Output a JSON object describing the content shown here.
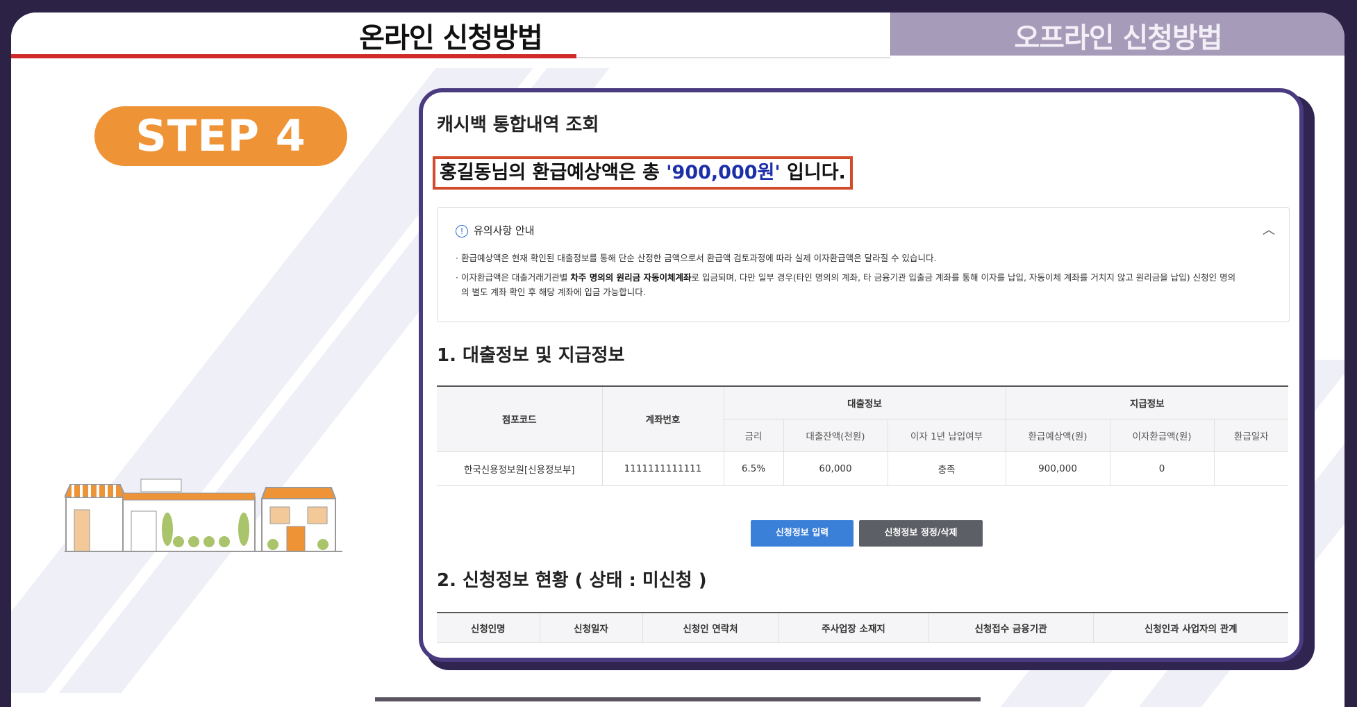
{
  "tabs": {
    "online": "온라인 신청방법",
    "offline": "오프라인 신청방법"
  },
  "step_label": "STEP 4",
  "card": {
    "title": "캐시백 통합내역 조회",
    "refund": {
      "prefix": "홍길동님의 환급예상액은 총 ",
      "amount": "'900,000원'",
      "suffix": " 입니다."
    },
    "notice": {
      "heading": "유의사항 안내",
      "line1": "· 환급예상액은 현재 확인된 대출정보를 통해 단순 산정한 금액으로서 환급액 검토과정에 따라 실제 이자환급액은 달라질 수 있습니다.",
      "line2_pre": "· 이자환급액은 대출거래기관별 ",
      "line2_bold": "차주 명의의 원리금 자동이체계좌",
      "line2_post": "로 입금되며, 다만 일부 경우(타인 명의의 계좌, 타 금융기관 입출금 계좌를 통해 이자를 납입, 자동이체 계좌를 거치지 않고 원리금을 납입) 신청인 명의",
      "line3": "의 별도 계좌 확인 후 해당 계좌에 입금 가능합니다."
    },
    "section1_title": "1. 대출정보 및 지급정보",
    "table1": {
      "h_branch": "점포코드",
      "h_account": "계좌번호",
      "h_loan": "대출정보",
      "h_pay": "지급정보",
      "h_rate": "금리",
      "h_balance": "대출잔액(천원)",
      "h_interest_paid": "이자 1년 납입여부",
      "h_expected": "환급예상액(원)",
      "h_interest_refund": "이자환급액(원)",
      "h_refund_date": "환급일자",
      "row": {
        "branch": "한국신용정보원[신용정보부]",
        "account": "1111111111111",
        "rate": "6.5%",
        "balance": "60,000",
        "interest_paid": "충족",
        "expected": "900,000",
        "interest_refund": "0",
        "refund_date": ""
      }
    },
    "buttons": {
      "input": "신청정보 입력",
      "edit": "신청정보 정정/삭제"
    },
    "section2_title": "2. 신청정보 현황 ( 상태 : 미신청 )",
    "table2_headers": [
      "신청인명",
      "신청일자",
      "신청인 연락처",
      "주사업장 소재지",
      "신청접수 금융기관",
      "신청인과 사업자의 관계"
    ]
  },
  "colors": {
    "accent_red": "#d02a2a",
    "step_orange": "#ef9436",
    "amount_blue": "#1c2fa8",
    "button_blue": "#3a7fd8"
  }
}
